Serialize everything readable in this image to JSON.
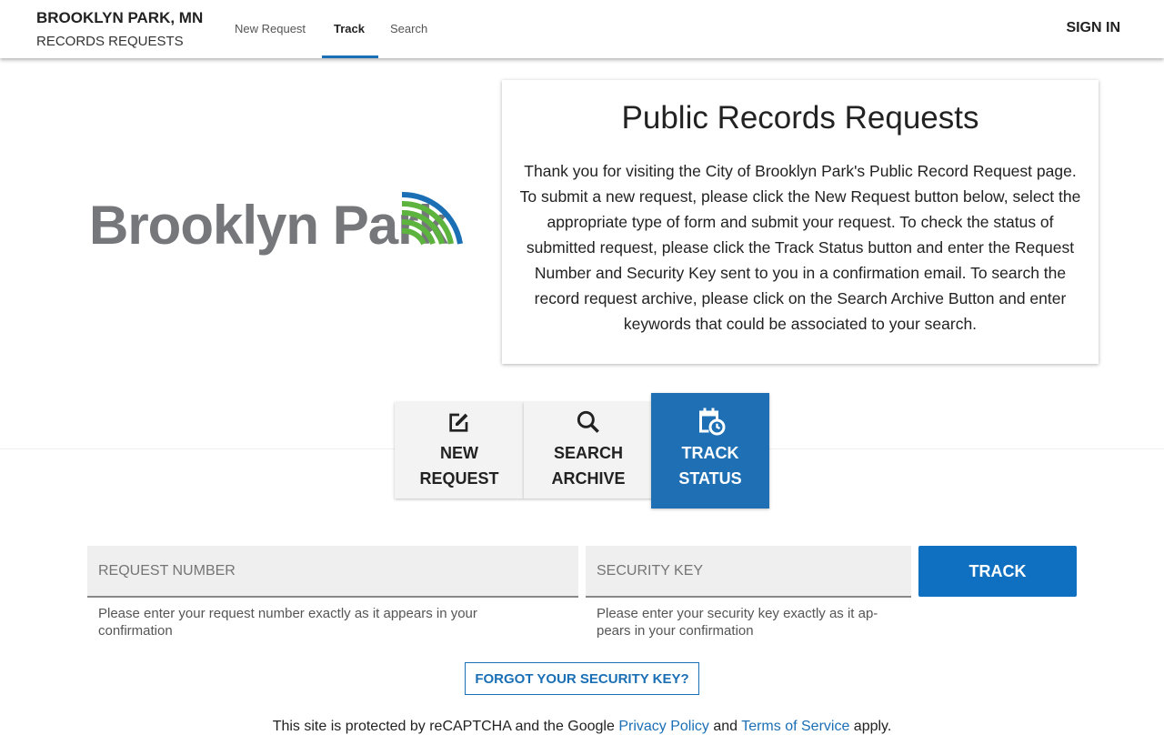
{
  "header": {
    "title": "BROOKLYN PARK, MN",
    "subtitle": "RECORDS REQUESTS",
    "nav": [
      {
        "label": "New Request"
      },
      {
        "label": "Track",
        "active": true
      },
      {
        "label": "Search"
      }
    ],
    "sign_in": "SIGN IN"
  },
  "logo": {
    "text": "Brooklyn Park",
    "colors": {
      "text": "#75777b",
      "green": "#5cb43e",
      "blue": "#1a6fb5"
    }
  },
  "intro": {
    "title": "Public Records Requests",
    "body": "Thank you for visiting the City of Brooklyn Park's Public Record Request page. To submit a new request, please click the New Request button below, select the appropriate type of form and submit your request. To check the status of submitted request, please click the Track Status button and enter the Request Number and Security Key sent to you in a confirmation email. To search the record request archive, please click on the Search Archive Button and enter keywords that could be associated to your search."
  },
  "tabs": [
    {
      "line1": "NEW",
      "line2": "REQUEST",
      "icon": "edit-icon"
    },
    {
      "line1": "SEARCH",
      "line2": "ARCHIVE",
      "icon": "search-icon"
    },
    {
      "line1": "TRACK",
      "line2": "STATUS",
      "icon": "calendar-clock-icon",
      "active": true
    }
  ],
  "form": {
    "request_number": {
      "placeholder": "REQUEST NUMBER",
      "value": "",
      "hint": "Please enter your request number exactly as it appears in your confirmation"
    },
    "security_key": {
      "placeholder": "SECURITY KEY",
      "value": "",
      "hint": "Please enter your security key exactly as it ap-pears in your confirmation"
    },
    "track_label": "TRACK",
    "forgot_label": "FORGOT YOUR SECURITY KEY?"
  },
  "footer": {
    "pre": "This site is protected by reCAPTCHA and the Google ",
    "privacy": "Privacy Policy",
    "mid": " and ",
    "terms": "Terms of Service",
    "post": " apply."
  },
  "accent": "#1e6fb4"
}
